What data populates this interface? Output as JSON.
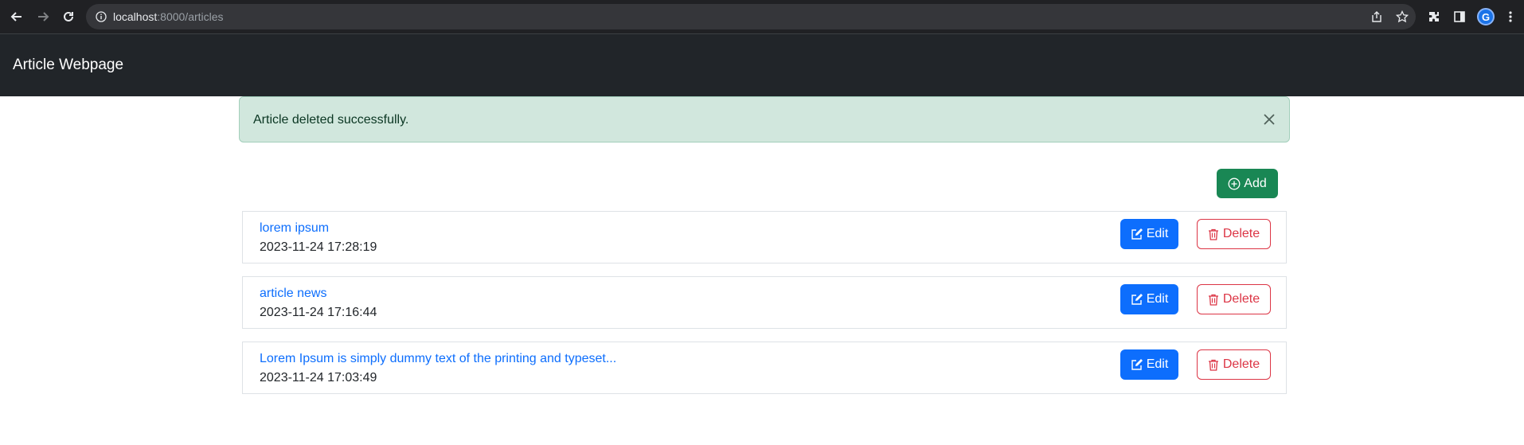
{
  "browser": {
    "url_host": "localhost",
    "url_rest": ":8000/articles",
    "profile_initial": "G"
  },
  "navbar": {
    "brand": "Article Webpage"
  },
  "alert": {
    "message": "Article deleted successfully."
  },
  "toolbar": {
    "add_label": "Add"
  },
  "articles": [
    {
      "title": "lorem ipsum",
      "date": "2023-11-24 17:28:19",
      "edit_label": "Edit",
      "delete_label": "Delete"
    },
    {
      "title": "article news",
      "date": "2023-11-24 17:16:44",
      "edit_label": "Edit",
      "delete_label": "Delete"
    },
    {
      "title": "Lorem Ipsum is simply dummy text of the printing and typeset...",
      "date": "2023-11-24 17:03:49",
      "edit_label": "Edit",
      "delete_label": "Delete"
    }
  ],
  "colors": {
    "navbar_bg": "#212529",
    "alert_bg": "#d1e7dd",
    "add_button": "#198754",
    "edit_button": "#0d6efd",
    "delete_button": "#dc3545",
    "link": "#0d6efd"
  }
}
